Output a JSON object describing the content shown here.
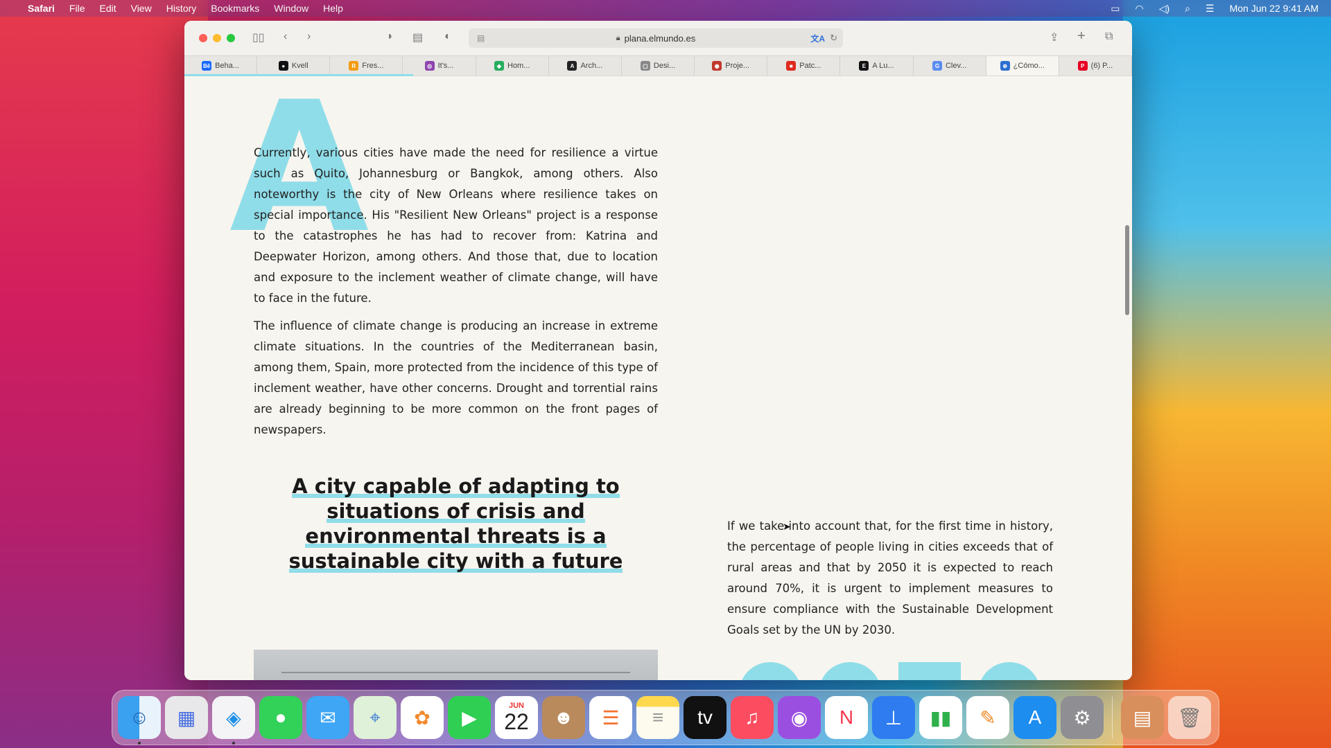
{
  "menubar": {
    "app": "Safari",
    "items": [
      "File",
      "Edit",
      "View",
      "History",
      "Bookmarks",
      "Window",
      "Help"
    ],
    "clock": "Mon Jun 22  9:41 AM"
  },
  "browser": {
    "url": "plana.elmundo.es",
    "tabs": [
      {
        "label": "Beha...",
        "color": "#1769ff",
        "glyph": "Bē"
      },
      {
        "label": "Kvell",
        "color": "#111111",
        "glyph": "●"
      },
      {
        "label": "Fres...",
        "color": "#f39c12",
        "glyph": "R"
      },
      {
        "label": "It's...",
        "color": "#8e44ad",
        "glyph": "◎"
      },
      {
        "label": "Hom...",
        "color": "#27ae60",
        "glyph": "◆"
      },
      {
        "label": "Arch...",
        "color": "#222222",
        "glyph": "A"
      },
      {
        "label": "Desi...",
        "color": "#888888",
        "glyph": "▢"
      },
      {
        "label": "Proje...",
        "color": "#c0392b",
        "glyph": "◉"
      },
      {
        "label": "Patc...",
        "color": "#e02a1f",
        "glyph": "■"
      },
      {
        "label": "A Lu...",
        "color": "#111111",
        "glyph": "E"
      },
      {
        "label": "Clev...",
        "color": "#5b8def",
        "glyph": "G"
      },
      {
        "label": "¿Cómo...",
        "color": "#2c6fd1",
        "glyph": "⊕"
      },
      {
        "label": "(6) P...",
        "color": "#e60023",
        "glyph": "P"
      }
    ],
    "active_tab_index": 11
  },
  "article": {
    "dropcap": "A",
    "paragraph1": "Currently, various cities have made the need for resilience a virtue such as Quito, Johannesburg or Bangkok, among others. Also noteworthy is the city of New Orleans where resilience takes on special importance. His \"Resilient New Orleans\" project is a response to the catastrophes he has had to recover from: Katrina and Deepwater Horizon, among others. And those that, due to location and exposure to the inclement weather of climate change, will have to face in the future.",
    "paragraph2": "The influence of climate change is producing an increase in extreme climate situations. In the countries of the Mediterranean basin, among them, Spain, more protected from the incidence of this type of inclement weather, have other concerns. Drought and torrential rains are already beginning to be more common on the front pages of newspapers.",
    "headline": "A city capable of adapting to situations of crisis and environmental threats is a sustainable city with a future",
    "paragraph3": "If we take into account that, for the first time in history, the percentage of people living in cities exceeds that of rural areas and that by 2050 it is expected to reach around 70%, it is urgent to implement measures to ensure compliance with the Sustainable Development Goals set by the UN by 2030."
  },
  "dock": {
    "calendar_month": "JUN",
    "calendar_day": "22",
    "apps": [
      "finder",
      "launchpad",
      "safari",
      "messages",
      "mail",
      "maps",
      "photos",
      "facetime",
      "calendar",
      "contacts",
      "reminders",
      "notes",
      "tv",
      "music",
      "podcasts",
      "news",
      "keynote",
      "numbers",
      "pages",
      "app-store",
      "system-preferences",
      "downloads",
      "trash"
    ]
  },
  "colors": {
    "accent": "#8fdde9",
    "page_bg": "#f7f5ef"
  }
}
